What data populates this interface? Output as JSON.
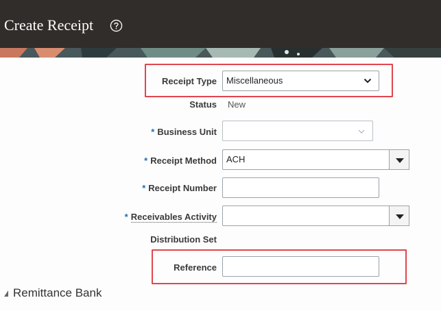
{
  "header": {
    "title": "Create Receipt",
    "help_icon": "help-circle-icon"
  },
  "form": {
    "receipt_type": {
      "label": "Receipt Type",
      "value": "Miscellaneous"
    },
    "status": {
      "label": "Status",
      "value": "New"
    },
    "business_unit": {
      "label": "Business Unit",
      "required": "*",
      "value": ""
    },
    "receipt_method": {
      "label": "Receipt Method",
      "required": "*",
      "value": "ACH"
    },
    "receipt_number": {
      "label": "Receipt Number",
      "required": "*",
      "value": ""
    },
    "receivables_activity": {
      "label": "Receivables Activity",
      "required": "*",
      "value": ""
    },
    "distribution_set": {
      "label": "Distribution Set"
    },
    "reference": {
      "label": "Reference",
      "value": ""
    }
  },
  "sections": {
    "remittance_bank": "Remittance Bank"
  },
  "colors": {
    "header_bg": "#312d2a",
    "highlight": "#e0454d",
    "required": "#1f6fb5"
  }
}
